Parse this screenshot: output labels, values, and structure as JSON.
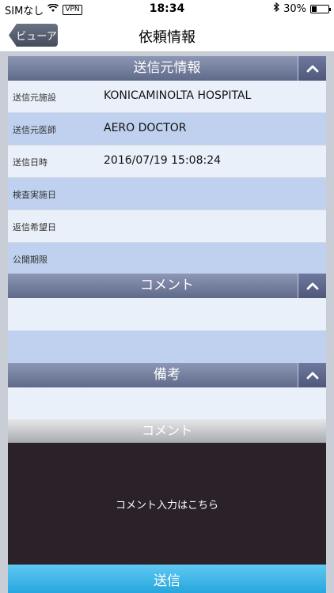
{
  "status_bar": {
    "carrier": "SIMなし",
    "vpn": "VPN",
    "time": "18:34",
    "battery": "30%",
    "battery_level": 0.3
  },
  "nav": {
    "back_label": "ビューア",
    "title": "依頼情報"
  },
  "sender_section": {
    "title": "送信元情報",
    "rows": [
      {
        "label": "送信元施設",
        "value": "KONICAMINOLTA HOSPITAL"
      },
      {
        "label": "送信元医師",
        "value": "AERO DOCTOR"
      },
      {
        "label": "送信日時",
        "value": "2016/07/19 15:08:24"
      },
      {
        "label": "検査実施日",
        "value": ""
      },
      {
        "label": "返信希望日",
        "value": ""
      },
      {
        "label": "公開期限",
        "value": ""
      }
    ]
  },
  "comment_section": {
    "title": "コメント"
  },
  "remarks_section": {
    "title": "備考"
  },
  "comment_input": {
    "header": "コメント",
    "placeholder": "コメント入力はこちら"
  },
  "send_button": {
    "label": "送信"
  },
  "colors": {
    "header_gradient_top": "#8d97b5",
    "row_light": "#eaf0f9",
    "row_dark": "#bfd1ee",
    "comment_area": "#2b2129",
    "send_button": "#1a9fd9"
  }
}
